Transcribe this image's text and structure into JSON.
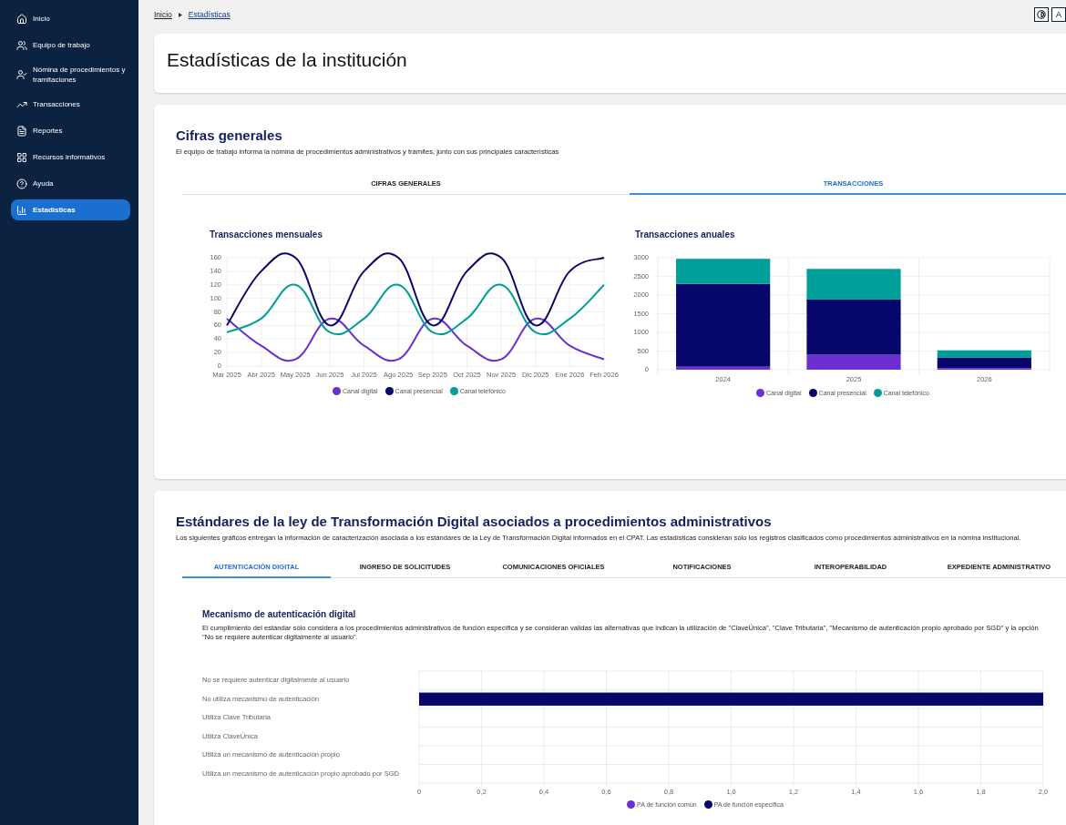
{
  "sidebar": {
    "items": [
      {
        "label": "Inicio",
        "selected": false
      },
      {
        "label": "Equipo de trabajo",
        "selected": false
      },
      {
        "label": "Nómina de procedimientos y tramitaciones",
        "selected": false
      },
      {
        "label": "Transacciones",
        "selected": false
      },
      {
        "label": "Reportes",
        "selected": false
      },
      {
        "label": "Recursos informativos",
        "selected": false
      },
      {
        "label": "Ayuda",
        "selected": false
      },
      {
        "label": "Estadísticas",
        "selected": true
      }
    ]
  },
  "breadcrumb": [
    {
      "label": "Inicio"
    },
    {
      "label": "Estadísticas"
    }
  ],
  "toolbar": {
    "buttons": [
      {
        "kind": "contrast"
      },
      {
        "kind": "text",
        "label": "A"
      }
    ]
  },
  "page_title": "Estadísticas de la institución",
  "general": {
    "title": "Cifras generales",
    "description": "El equipo de trabajo informa la nómina de procedimientos administrativos y trámites, junto con sus principales características",
    "tabs": [
      {
        "label": "CIFRAS GENERALES",
        "selected": false
      },
      {
        "label": "TRANSACCIONES",
        "selected": true
      }
    ],
    "charts": [
      {
        "chart_data": {
          "type": "line",
          "title": "Transacciones mensuales",
          "grid": true,
          "categories": [
            "Mar 2025",
            "Abr 2025",
            "May 2025",
            "Jun 2025",
            "Jul 2025",
            "Ago 2025",
            "Sep 2025",
            "Oct 2025",
            "Nov 2025",
            "Dic 2025",
            "Ene 2026",
            "Feb 2026"
          ],
          "ylim": [
            0,
            160
          ],
          "yticks": [
            0,
            20,
            40,
            60,
            80,
            100,
            120,
            140,
            160
          ],
          "series": [
            {
              "name": "Canal digital",
              "color": "#6d2fd0",
              "values": [
                70,
                30,
                10,
                70,
                30,
                10,
                70,
                30,
                10,
                70,
                30,
                10
              ]
            },
            {
              "name": "Canal presencial",
              "color": "#07076b",
              "values": [
                60,
                140,
                160,
                60,
                140,
                160,
                60,
                140,
                160,
                60,
                140,
                160
              ]
            },
            {
              "name": "Canal telefónico",
              "color": "#009e98",
              "values": [
                50,
                70,
                120,
                50,
                70,
                120,
                50,
                70,
                120,
                50,
                70,
                120
              ]
            }
          ]
        }
      },
      {
        "chart_data": {
          "type": "bar",
          "title": "Transacciones anuales",
          "grid": true,
          "stacked": true,
          "orientation": "vertical",
          "categories": [
            "2024",
            "2025",
            "2026"
          ],
          "ylim": [
            0,
            3000
          ],
          "yticks": [
            0,
            500,
            1000,
            1500,
            2000,
            2500,
            3000
          ],
          "series": [
            {
              "name": "Canal digital",
              "color": "#6d2fd0",
              "values": [
                80,
                400,
                40
              ]
            },
            {
              "name": "Canal presencial",
              "color": "#07076b",
              "values": [
                2220,
                1480,
                290
              ]
            },
            {
              "name": "Canal telefónico",
              "color": "#009e98",
              "values": [
                670,
                820,
                190
              ]
            }
          ]
        }
      }
    ]
  },
  "standards": {
    "title": "Estándares de la ley de Transformación Digital asociados a procedimientos administrativos",
    "description": "Los siguientes gráficos entregan la información de caracterización asociada a los estándares de la Ley de Transformación Digital informados en el CPAT. Las estadísticas consideran sólo los registros clasificados como procedimientos administrativos en la nómina institucional.",
    "tabs": [
      {
        "label": "AUTENTICACIÓN DIGITAL",
        "selected": true
      },
      {
        "label": "INGRESO DE SOLICITUDES",
        "selected": false
      },
      {
        "label": "COMUNICACIONES OFICIALES",
        "selected": false
      },
      {
        "label": "NOTIFICACIONES",
        "selected": false
      },
      {
        "label": "INTEROPERABILIDAD",
        "selected": false
      },
      {
        "label": "EXPEDIENTE ADMINISTRATIVO",
        "selected": false
      }
    ],
    "section": {
      "title": "Mecanismo de autenticación digital",
      "description": "El cumplimiento del estándar sólo considera a los procedimientos administrativos de función específica y se consideran validas las alternativas que indican la utilización de \"ClaveÚnica\", \"Clave Tributaria\", \"Mecanismo de autenticación propio aprobado por SGD\" y la opción \"No se requiere autenticar digitalmente al usuario\".",
      "chart_data": {
        "type": "bar",
        "orientation": "horizontal",
        "grid": true,
        "categories": [
          "No se requiere autenticar digitalmente al usuario",
          "No utiliza mecanismo de autenticación",
          "Utiliza Clave Tributaria",
          "Utiliza ClaveÚnica",
          "Utiliza un mecanismo de autenticación propio",
          "Utiliza un mecanismo de autenticación propio aprobado por SGD"
        ],
        "xlim": [
          0,
          2
        ],
        "xticks": [
          {
            "value": 0,
            "label": "0"
          },
          {
            "value": 0.2,
            "label": "0,2"
          },
          {
            "value": 0.4,
            "label": "0,4"
          },
          {
            "value": 0.6,
            "label": "0,6"
          },
          {
            "value": 0.8,
            "label": "0,8"
          },
          {
            "value": 1,
            "label": "1,0"
          },
          {
            "value": 1.2,
            "label": "1,2"
          },
          {
            "value": 1.4,
            "label": "1,4"
          },
          {
            "value": 1.6,
            "label": "1,6"
          },
          {
            "value": 1.8,
            "label": "1,8"
          },
          {
            "value": 2,
            "label": "2,0"
          }
        ],
        "series": [
          {
            "name": "PA de función común",
            "color": "#6d2fd0",
            "values": [
              0,
              0,
              0,
              0,
              0,
              0
            ]
          },
          {
            "name": "PA de función específica",
            "color": "#07076b",
            "values": [
              0,
              2,
              0,
              0,
              0,
              0
            ]
          }
        ]
      }
    }
  }
}
